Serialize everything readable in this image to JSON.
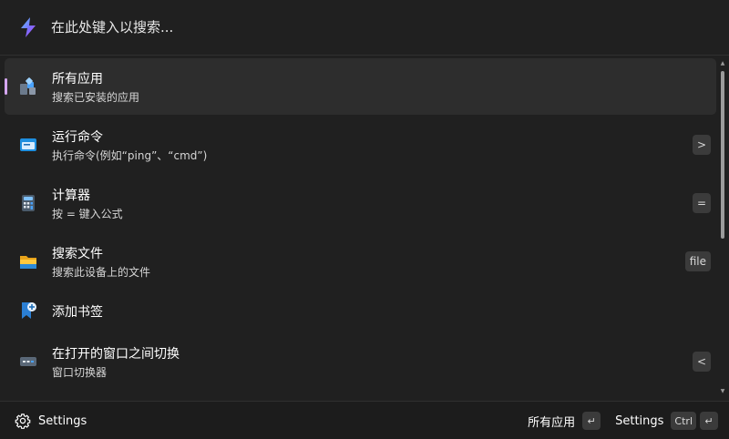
{
  "search": {
    "placeholder": "在此处键入以搜索...",
    "value": ""
  },
  "results": [
    {
      "title": "所有应用",
      "subtitle": "搜索已安装的应用",
      "shortcut": "",
      "icon": "all-apps-icon",
      "selected": true
    },
    {
      "title": "运行命令",
      "subtitle": "执行命令(例如“ping”、“cmd”)",
      "shortcut": ">",
      "icon": "run-command-icon"
    },
    {
      "title": "计算器",
      "subtitle": "按 = 键入公式",
      "shortcut": "=",
      "icon": "calculator-icon"
    },
    {
      "title": "搜索文件",
      "subtitle": "搜索此设备上的文件",
      "shortcut": "file",
      "icon": "folder-icon"
    },
    {
      "title": "添加书签",
      "subtitle": "",
      "shortcut": "",
      "icon": "add-bookmark-icon"
    },
    {
      "title": "在打开的窗口之间切换",
      "subtitle": "窗口切换器",
      "shortcut": "<",
      "icon": "window-switcher-icon"
    }
  ],
  "footer": {
    "settings_label": "Settings",
    "primary_action_label": "所有应用",
    "primary_action_key": "↵",
    "secondary_action_label": "Settings",
    "secondary_action_modifier": "Ctrl",
    "secondary_action_key": "↵"
  },
  "colors": {
    "background": "#202020",
    "selected_row": "#2d2d2d",
    "accent_indicator": "#d4a6f0",
    "badge": "#3b3b3b"
  }
}
